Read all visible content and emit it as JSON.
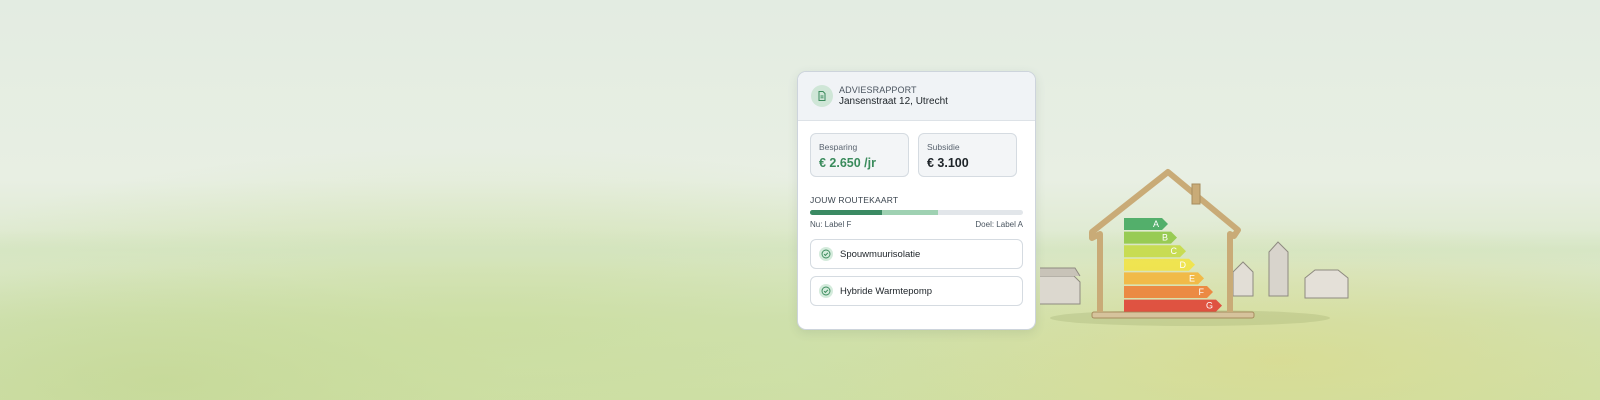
{
  "report": {
    "kicker": "ADVIESRAPPORT",
    "address": "Jansenstraat 12, Utrecht",
    "icon": "document-icon"
  },
  "stats": {
    "savings": {
      "label": "Besparing",
      "value": "€ 2.650 /jr"
    },
    "subsidy": {
      "label": "Subsidie",
      "value": "€ 3.100"
    }
  },
  "roadmap": {
    "title": "JOUW ROUTEKAART",
    "current_label": "Nu: Label F",
    "target_label": "Doel: Label A",
    "progress_done_fraction": 0.34,
    "progress_planned_fraction": 0.6
  },
  "measures": [
    {
      "label": "Spouwmuurisolatie",
      "icon": "check-circle-icon"
    },
    {
      "label": "Hybride Warmtepomp",
      "icon": "check-circle-icon"
    }
  ],
  "energy_labels": [
    "A",
    "B",
    "C",
    "D",
    "E",
    "F",
    "G"
  ],
  "colors": {
    "accent_green": "#3a8b5c",
    "label_A": "#3aa558",
    "label_B": "#8cc63f",
    "label_C": "#c5d940",
    "label_D": "#f2e33d",
    "label_E": "#f5b335",
    "label_F": "#ee7a30",
    "label_G": "#e03a2f"
  }
}
